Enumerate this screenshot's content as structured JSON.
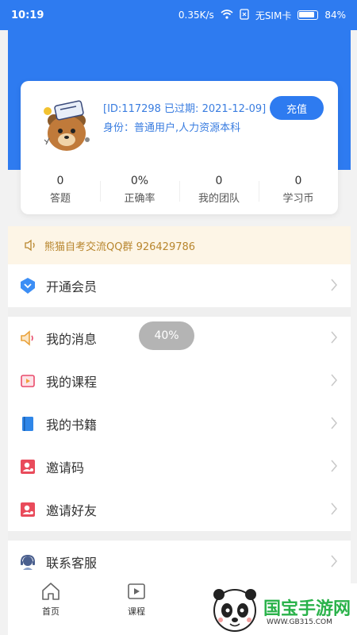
{
  "status_bar": {
    "time": "10:19",
    "speed": "0.35K/s",
    "sim": "无SIM卡",
    "battery": "84%"
  },
  "profile": {
    "id_expiry": "[ID:117298 已过期: 2021-12-09]",
    "role": "身份：普通用户,人力资源本科",
    "recharge_label": "充值",
    "stats": [
      {
        "value": "0",
        "label": "答题"
      },
      {
        "value": "0%",
        "label": "正确率"
      },
      {
        "value": "0",
        "label": "我的团队"
      },
      {
        "value": "0",
        "label": "学习币"
      }
    ]
  },
  "notice": "熊猫自考交流QQ群 926429786",
  "menu": {
    "vip": "开通会员",
    "messages": "我的消息",
    "courses": "我的课程",
    "books": "我的书籍",
    "invite_code": "邀请码",
    "invite_friends": "邀请好友",
    "support": "联系客服"
  },
  "toast": "40%",
  "tabs": {
    "home": "首页",
    "course": "课程"
  },
  "watermark": {
    "brand": "国宝手游网",
    "url": "WWW.GB315.COM"
  },
  "colors": {
    "primary": "#2e7bf0",
    "notice_bg": "#fdf5e6",
    "notice_text": "#b8862e"
  },
  "icons": [
    "wifi-icon",
    "sim-icon",
    "battery-icon",
    "speaker-icon",
    "vip-icon",
    "message-icon",
    "course-icon",
    "book-icon",
    "invite-icon",
    "support-icon",
    "home-icon",
    "play-icon",
    "chevron-right-icon"
  ]
}
